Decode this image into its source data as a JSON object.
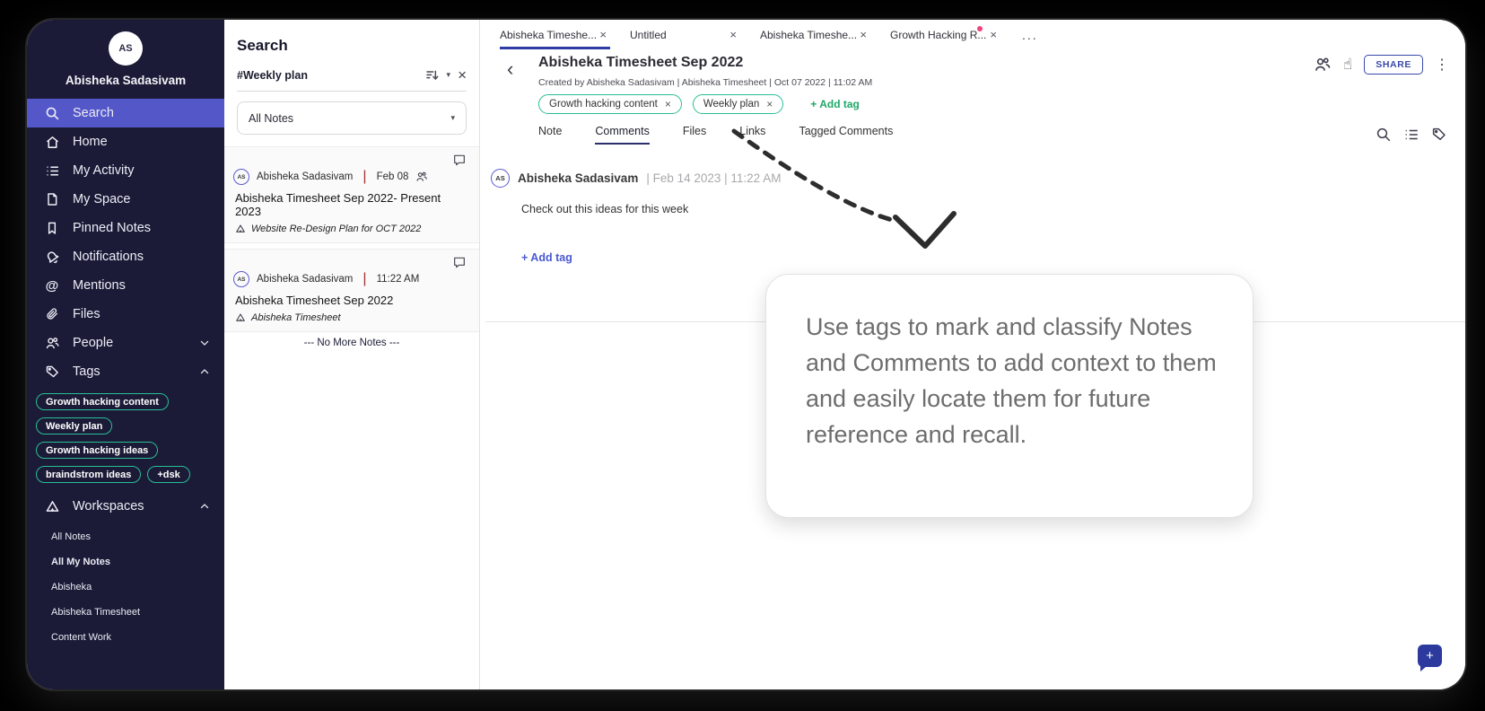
{
  "colors": {
    "sidebar_bg": "#1b1b38",
    "sidebar_active": "#5457c8",
    "tag_teal": "#2abd96",
    "add_tag_green": "#1fa868",
    "add_tag_indigo": "#4a5ad2",
    "share_blue": "#3949ab",
    "doc_tab_underline": "#2f3ca5",
    "view_tab_underline": "#2b2f6e",
    "unread_dot": "#f0427c",
    "chat_bubble": "#2c3a9e",
    "result_pipe": "#9c2b2b"
  },
  "glyphs": {
    "close": "×",
    "caret_down": "▾",
    "back": "‹",
    "more_menu": "⋮",
    "more_tabs": "...",
    "plus": "+",
    "pipe": "|",
    "at": "@",
    "hand": "☝"
  },
  "sidebar": {
    "avatar_initials": "AS",
    "user_name": "Abisheka Sadasivam",
    "items": [
      {
        "label": "Search"
      },
      {
        "label": "Home"
      },
      {
        "label": "My Activity"
      },
      {
        "label": "My Space"
      },
      {
        "label": "Pinned Notes"
      },
      {
        "label": "Notifications"
      },
      {
        "label": "Mentions"
      },
      {
        "label": "Files"
      }
    ],
    "people_label": "People",
    "tags_label": "Tags",
    "tag_pills": [
      "Growth hacking content",
      "Weekly plan",
      "Growth hacking ideas",
      "braindstrom ideas",
      "+dsk"
    ],
    "workspaces_label": "Workspaces",
    "workspace_links": [
      "All Notes",
      "All My Notes",
      "Abisheka",
      "Abisheka Timesheet",
      "Content Work"
    ]
  },
  "search_panel": {
    "title": "Search",
    "query": "#Weekly plan",
    "filter_value": "All Notes",
    "results": [
      {
        "avatar": "AS",
        "author": "Abisheka Sadasivam",
        "time": "Feb 08",
        "title": "Abisheka Timesheet Sep 2022- Present 2023",
        "workspace": "Website Re-Design Plan for OCT 2022"
      },
      {
        "avatar": "AS",
        "author": "Abisheka Sadasivam",
        "time": "11:22 AM",
        "title": "Abisheka Timesheet Sep 2022",
        "workspace": "Abisheka Timesheet"
      }
    ],
    "end_text": "--- No More Notes ---"
  },
  "doc_tabs": {
    "tabs": [
      {
        "label": "Abisheka Timeshe..."
      },
      {
        "label": "Untitled"
      },
      {
        "label": "Abisheka Timeshe..."
      },
      {
        "label": "Growth Hacking R..."
      }
    ]
  },
  "document": {
    "title": "Abisheka Timesheet Sep 2022",
    "meta": "Created by  Abisheka Sadasivam  |  Abisheka Timesheet  | Oct 07 2022 | 11:02 AM",
    "tags": [
      "Growth hacking content",
      "Weekly plan"
    ],
    "add_tag_label": "+ Add tag",
    "view_tabs": [
      "Note",
      "Comments",
      "Files",
      "Links",
      "Tagged Comments"
    ],
    "share_label": "SHARE"
  },
  "comment": {
    "avatar": "AS",
    "author": "Abisheka Sadasivam",
    "meta": "| Feb 14 2023 | 11:22 AM",
    "body": "Check out this ideas for this week",
    "add_tag_label": "+ Add tag"
  },
  "tooltip": {
    "text": "Use tags to mark and classify Notes and Comments to add context to them and easily locate them for future reference and recall."
  }
}
